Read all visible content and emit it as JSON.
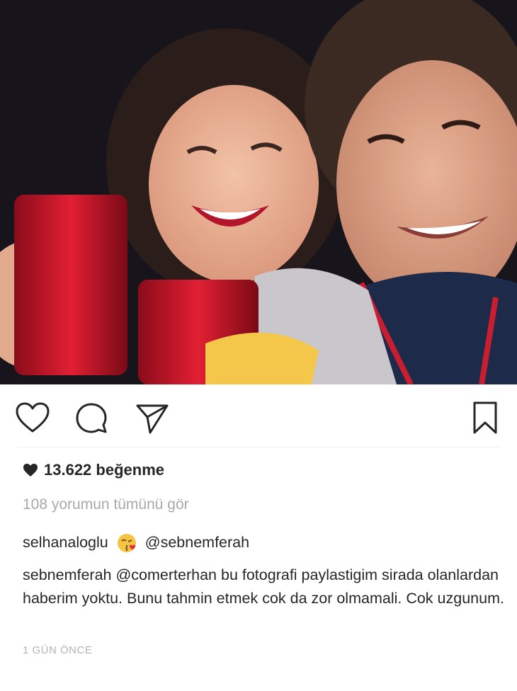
{
  "post": {
    "likes_text": "13.622 beğenme",
    "view_comments": "108 yorumun tümünü gör",
    "comments": [
      {
        "user": "selhanaloglu",
        "emoji": "kissing-face-emoji",
        "mention": "@sebnemferah",
        "text": ""
      },
      {
        "user": "sebnemferah",
        "mention": "@comerterhan",
        "text": " bu fotografi paylastigim sirada olanlardan haberim yoktu. Bunu tahmin etmek cok da zor olmamali. Cok uzgunum."
      }
    ],
    "timestamp": "1 GÜN ÖNCE"
  },
  "icons": {
    "like": "heart-outline-icon",
    "comment": "speech-bubble-icon",
    "share": "paper-plane-icon",
    "save": "bookmark-icon",
    "likes_heart": "heart-filled-icon"
  },
  "colors": {
    "text": "#262626",
    "muted": "#a9a9a9",
    "cup_red": "#c8102e"
  }
}
